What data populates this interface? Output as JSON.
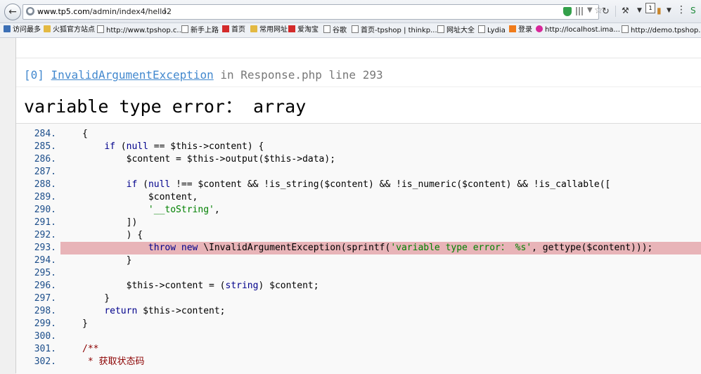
{
  "browser": {
    "url_domain": "www.tp5.com",
    "url_path": "/admin/index4/hello2",
    "badge_count": "1"
  },
  "bookmarks": [
    {
      "label": "访问最多",
      "icon": "book"
    },
    {
      "label": "火狐官方站点",
      "icon": "folder"
    },
    {
      "label": "http://www.tpshop.c...",
      "icon": "page"
    },
    {
      "label": "新手上路",
      "icon": "page"
    },
    {
      "label": "首页",
      "icon": "red"
    },
    {
      "label": "常用网址",
      "icon": "folder"
    },
    {
      "label": "爱淘宝",
      "icon": "red"
    },
    {
      "label": "谷歌",
      "icon": "page"
    },
    {
      "label": "首页-tpshop | thinkp...",
      "icon": "page"
    },
    {
      "label": "网址大全",
      "icon": "page"
    },
    {
      "label": "Lydia",
      "icon": "page"
    },
    {
      "label": "登录",
      "icon": "orange"
    },
    {
      "label": "http://localhost.ima...",
      "icon": "pink"
    },
    {
      "label": "http://demo.tpshop....",
      "icon": "page"
    }
  ],
  "exception": {
    "index": "[0]",
    "class": "InvalidArgumentException",
    "in_word": "in",
    "file": "Response.php",
    "line_word": "line",
    "line": "293",
    "message": "variable type error： array"
  },
  "code": {
    "highlight_line": "293.",
    "lines": [
      {
        "n": "284.",
        "text": "    {"
      },
      {
        "n": "285.",
        "text": "        if (null == $this->content) {"
      },
      {
        "n": "286.",
        "text": "            $content = $this->output($this->data);"
      },
      {
        "n": "287.",
        "text": ""
      },
      {
        "n": "288.",
        "text": "            if (null !== $content && !is_string($content) && !is_numeric($content) && !is_callable(["
      },
      {
        "n": "289.",
        "text": "                $content,"
      },
      {
        "n": "290.",
        "text": "                '__toString',"
      },
      {
        "n": "291.",
        "text": "            ])"
      },
      {
        "n": "292.",
        "text": "            ) {"
      },
      {
        "n": "293.",
        "text": "                throw new \\InvalidArgumentException(sprintf('variable type error： %s', gettype($content)));"
      },
      {
        "n": "294.",
        "text": "            }"
      },
      {
        "n": "295.",
        "text": ""
      },
      {
        "n": "296.",
        "text": "            $this->content = (string) $content;"
      },
      {
        "n": "297.",
        "text": "        }"
      },
      {
        "n": "298.",
        "text": "        return $this->content;"
      },
      {
        "n": "299.",
        "text": "    }"
      },
      {
        "n": "300.",
        "text": ""
      },
      {
        "n": "301.",
        "text": "    /**"
      },
      {
        "n": "302.",
        "text": "     * 获取状态码"
      }
    ]
  }
}
